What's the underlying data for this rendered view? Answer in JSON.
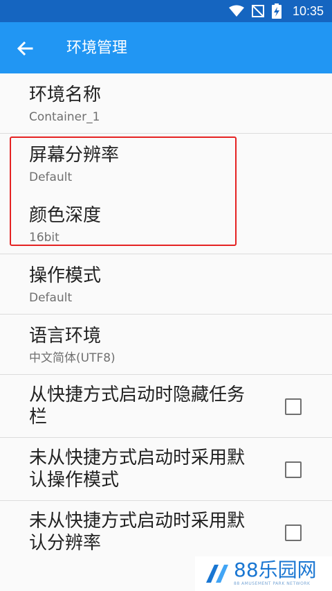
{
  "status_bar": {
    "time": "10:35",
    "icons": [
      "wifi-icon",
      "no-signal-icon",
      "battery-charging-icon"
    ]
  },
  "toolbar": {
    "title": "环境管理",
    "back_icon": "arrow-back-icon"
  },
  "preferences": [
    {
      "title": "环境名称",
      "summary": "Container_1"
    },
    {
      "title": "屏幕分辨率",
      "summary": "Default"
    },
    {
      "title": "颜色深度",
      "summary": "16bit"
    },
    {
      "title": "操作模式",
      "summary": "Default"
    },
    {
      "title": "语言环境",
      "summary": "中文简体(UTF8)"
    }
  ],
  "checkbox_options": [
    {
      "title_line1": "从快捷方式启动时隐藏任务",
      "title_line2": "栏",
      "checked": false
    },
    {
      "title_line1": "未从快捷方式启动时采用默",
      "title_line2": "认操作模式",
      "checked": false
    },
    {
      "title_line1": "未从快捷方式启动时采用默",
      "title_line2": "认分辨率",
      "checked": false
    }
  ],
  "watermark": {
    "text": "88乐园网",
    "subtext": "88 AMUSEMENT PARK NETWORK"
  },
  "colors": {
    "status_bar": "#1565c0",
    "toolbar": "#2196f3",
    "highlight": "#e52222"
  }
}
